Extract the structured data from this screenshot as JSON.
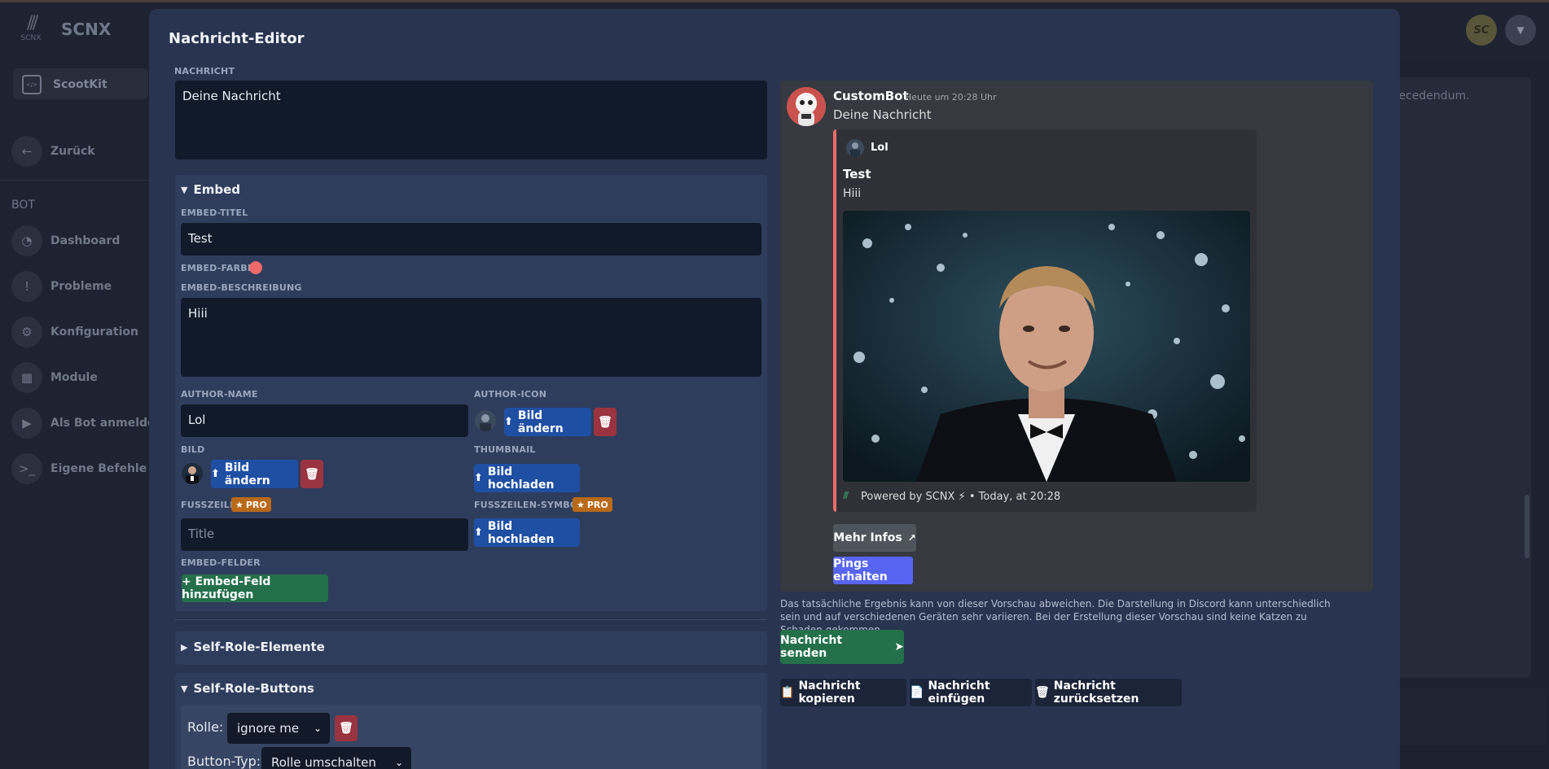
{
  "app": {
    "brand": "SCNX",
    "logo_text": "SCNX",
    "avatar_text": "SC"
  },
  "sidebar": {
    "server": "ScootKit",
    "back": "Zurück",
    "section": "BOT",
    "items": [
      {
        "label": "Dashboard",
        "icon": "gauge-icon"
      },
      {
        "label": "Probleme",
        "icon": "alert-icon"
      },
      {
        "label": "Konfiguration",
        "icon": "gears-icon"
      },
      {
        "label": "Module",
        "icon": "calendar-icon"
      },
      {
        "label": "Als Bot anmelden",
        "icon": "play-icon"
      },
      {
        "label": "Eigene Befehle",
        "icon": "terminal-icon"
      }
    ]
  },
  "background": {
    "content_text": "t recedendum."
  },
  "modal": {
    "title": "Nachricht-Editor",
    "message_label": "NACHRICHT",
    "message_value": "Deine Nachricht",
    "embed": {
      "summary": "Embed",
      "title_label": "EMBED-TITEL",
      "title_value": "Test",
      "color_label": "EMBED-FARBE",
      "color": "#f06a6a",
      "description_label": "EMBED-BESCHREIBUNG",
      "description_value": "Hiii",
      "author_name_label": "AUTHOR-NAME",
      "author_name_value": "Lol",
      "author_icon_label": "AUTHOR-ICON",
      "change_image": "Bild ändern",
      "image_label": "BILD",
      "thumbnail_label": "THUMBNAIL",
      "upload_image": "Bild hochladen",
      "footer_label": "FUSSZEILE",
      "footer_placeholder": "Title",
      "footer_icon_label": "FUSSZEILEN-SYMBOL",
      "pro": "PRO",
      "fields_label": "EMBED-FELDER",
      "add_field": "+ Embed-Feld hinzufügen"
    },
    "self_role_elements": "Self-Role-Elemente",
    "self_role_buttons": {
      "summary": "Self-Role-Buttons",
      "role_label": "Rolle:",
      "role_value": "ignore me",
      "type_label": "Button-Typ:",
      "type_value": "Rolle umschalten"
    },
    "preview": {
      "bot_name": "CustomBot",
      "timestamp": "Heute um 20:28 Uhr",
      "message": "Deine Nachricht",
      "embed_author": "Lol",
      "embed_title": "Test",
      "embed_description": "Hiii",
      "footer": "Powered by SCNX ⚡ • Today, at 20:28",
      "more_info": "Mehr Infos",
      "pings": "Pings erhalten"
    },
    "disclaimer": "Das tatsächliche Ergebnis kann von dieser Vorschau abweichen. Die Darstellung in Discord kann unterschiedlich sein und auf verschiedenen Geräten sehr variieren. Bei der Erstellung dieser Vorschau sind keine Katzen zu Schaden gekommen.",
    "send": "Nachricht senden",
    "copy": "Nachricht kopieren",
    "paste": "Nachricht einfügen",
    "reset": "Nachricht zurücksetzen"
  }
}
